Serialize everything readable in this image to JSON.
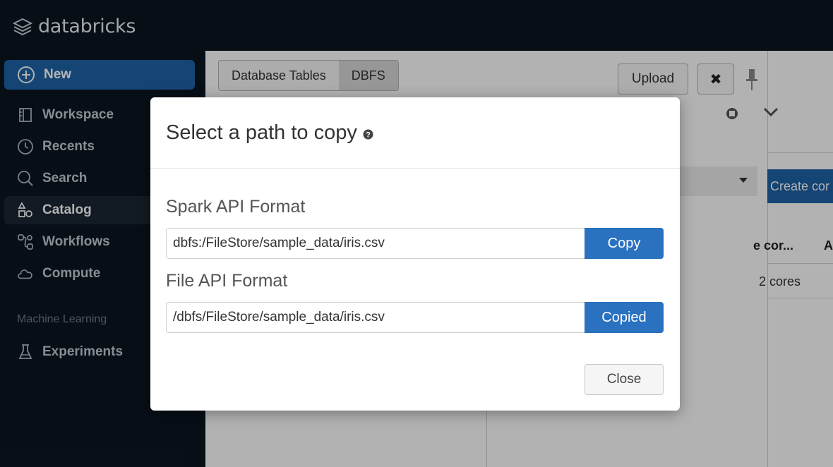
{
  "app": {
    "logo_text": "databricks"
  },
  "sidebar": {
    "new_label": "New",
    "items": [
      {
        "label": "Workspace",
        "icon": "workspace-icon"
      },
      {
        "label": "Recents",
        "icon": "clock-icon"
      },
      {
        "label": "Search",
        "icon": "search-icon"
      },
      {
        "label": "Catalog",
        "icon": "catalog-icon",
        "active": true
      },
      {
        "label": "Workflows",
        "icon": "workflows-icon"
      },
      {
        "label": "Compute",
        "icon": "cloud-icon"
      }
    ],
    "section_label": "Machine Learning",
    "ml_items": [
      {
        "label": "Experiments",
        "icon": "flask-icon"
      }
    ]
  },
  "main": {
    "tabs": [
      {
        "label": "Database Tables"
      },
      {
        "label": "DBFS",
        "active": true
      }
    ],
    "upload_label": "Upload",
    "close_symbol": "✖",
    "create_label": "Create cor",
    "col_head_1": "e cor...",
    "col_head_2": "A",
    "cell_1": "2 cores"
  },
  "modal": {
    "title": "Select a path to copy",
    "spark_label": "Spark API Format",
    "spark_path": "dbfs:/FileStore/sample_data/iris.csv",
    "spark_button": "Copy",
    "file_label": "File API Format",
    "file_path": "/dbfs/FileStore/sample_data/iris.csv",
    "file_button": "Copied",
    "close_label": "Close"
  },
  "colors": {
    "topbar_bg": "#0b1520",
    "accent": "#1e63a6",
    "copy_button": "#2a71c0"
  }
}
